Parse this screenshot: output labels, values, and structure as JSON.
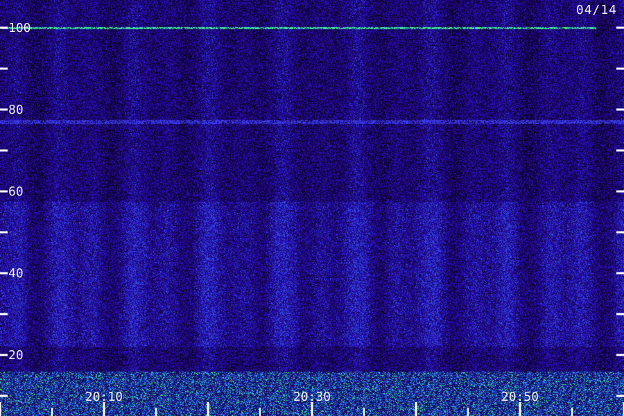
{
  "date_label": "04/14",
  "colors": {
    "background": "#14003a",
    "low": "#2a0a8a",
    "mid": "#3a2ad8",
    "high": "#2aa8ff",
    "peak": "#3cff88",
    "tick": "#ffffff"
  },
  "chart_data": {
    "type": "heatmap",
    "title": "",
    "xlabel": "",
    "ylabel": "",
    "x_range": [
      "20:00",
      "21:00"
    ],
    "ylim": [
      0,
      105
    ],
    "y_ticks": [
      {
        "value": 100,
        "label": "100"
      },
      {
        "value": 90,
        "label": ""
      },
      {
        "value": 80,
        "label": "80"
      },
      {
        "value": 70,
        "label": ""
      },
      {
        "value": 60,
        "label": "60"
      },
      {
        "value": 50,
        "label": ""
      },
      {
        "value": 40,
        "label": "40"
      },
      {
        "value": 30,
        "label": ""
      },
      {
        "value": 20,
        "label": "20"
      },
      {
        "value": 10,
        "label": ""
      }
    ],
    "x_major_ticks": [
      {
        "time": "20:10",
        "label": "20:10"
      },
      {
        "time": "20:30",
        "label": "20:30"
      },
      {
        "time": "20:50",
        "label": "20:50"
      },
      {
        "time": "20:00",
        "label": ""
      },
      {
        "time": "20:20",
        "label": ""
      },
      {
        "time": "20:40",
        "label": ""
      },
      {
        "time": "21:00",
        "label": ""
      }
    ],
    "x_minor_tick_minutes": 5,
    "bright_lines_y": [
      100,
      77
    ],
    "strong_band_below_y": 16
  }
}
